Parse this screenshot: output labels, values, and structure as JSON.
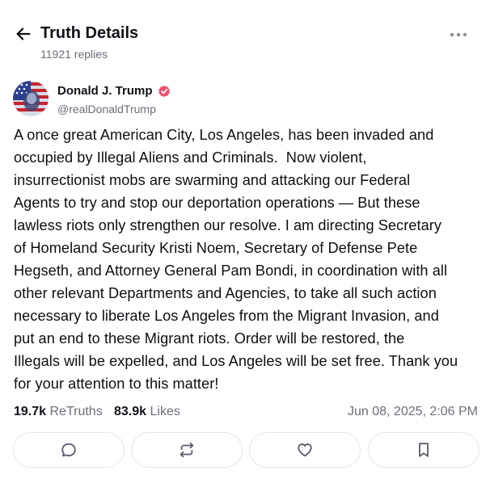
{
  "header": {
    "title": "Truth Details",
    "replies": "11921 replies"
  },
  "author": {
    "name": "Donald J. Trump",
    "handle": "@realDonaldTrump",
    "verified_color": "#f0506e"
  },
  "post": {
    "lines": [
      "A once great American City, Los Angeles, has been invaded and",
      "occupied by Illegal Aliens and Criminals.  Now violent,",
      "insurrectionist mobs are swarming and attacking our Federal",
      "Agents to try and stop our deportation operations — But these",
      "lawless riots only strengthen our resolve. I am directing Secretary",
      "of Homeland Security Kristi Noem, Secretary of Defense Pete",
      "Hegseth, and Attorney General Pam Bondi, in coordination with all",
      "other relevant Departments and Agencies, to take all such action",
      "necessary to liberate Los Angeles from the Migrant Invasion, and",
      "put an end to these Migrant riots. Order will be restored, the",
      "Illegals will be expelled, and Los Angeles will be set free. Thank you",
      "for your attention to this matter!"
    ]
  },
  "stats": {
    "retruths_count": "19.7k",
    "retruths_label": "ReTruths",
    "likes_count": "83.9k",
    "likes_label": "Likes",
    "timestamp": "Jun 08, 2025, 2:06 PM"
  },
  "icons": {
    "back": "arrow-left-icon",
    "more": "ellipsis-icon",
    "verified": "verified-check-icon",
    "reply": "comment-icon",
    "retruth": "repost-icon",
    "like": "heart-icon",
    "bookmark": "bookmark-icon"
  }
}
